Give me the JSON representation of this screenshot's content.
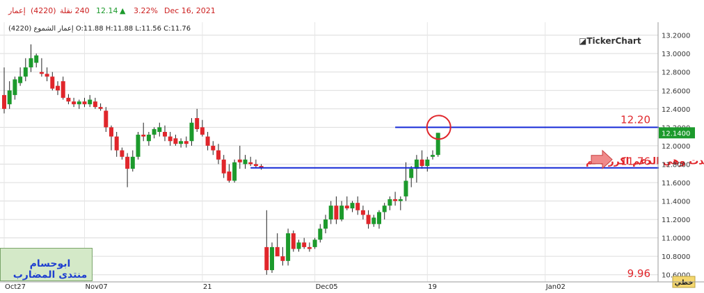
{
  "header": {
    "name": "إعمار",
    "code": "(4220)",
    "volume": "240 نقلة",
    "price": "12.14",
    "change_icon": "triangle-up-icon",
    "change_pct": "3.22%",
    "date": "Dec 16, 2021"
  },
  "ohlc_line": "(4220) إعمار الشموع O:11.88 H:11.88 L:11.56 C:11.76",
  "brand": "TickerChart",
  "author_box": {
    "line1": "ابوحسام",
    "line2": "منتدى المضارب"
  },
  "annotations": {
    "resistance_label": "12.20",
    "support_label": "11.76",
    "bottom_label": "9.96",
    "note": "عدت وهي الدعم اكرر دعم",
    "current_price": "12.1400",
    "mode_label": "خطي"
  },
  "colors": {
    "up": "#1c9a2c",
    "down": "#e0262b",
    "level_line": "#1428d6",
    "annotation": "#e0262b"
  },
  "chart_data": {
    "type": "candlestick",
    "x_tick_labels": [
      "Oct27",
      "Nov07",
      "21",
      "Dec05",
      "19",
      "Jan02"
    ],
    "y_tick_labels": [
      "10.6000",
      "10.8000",
      "11.0000",
      "11.2000",
      "11.4000",
      "11.6000",
      "11.8000",
      "12.0000",
      "12.2000",
      "12.4000",
      "12.6000",
      "12.8000",
      "13.0000",
      "13.2000"
    ],
    "ylim": [
      10.53,
      13.28
    ],
    "horizontal_levels": [
      12.2,
      11.76
    ],
    "candles": [
      {
        "o": 12.55,
        "h": 12.85,
        "l": 12.35,
        "c": 12.4
      },
      {
        "o": 12.45,
        "h": 12.7,
        "l": 12.4,
        "c": 12.6
      },
      {
        "o": 12.55,
        "h": 12.75,
        "l": 12.5,
        "c": 12.72
      },
      {
        "o": 12.68,
        "h": 12.85,
        "l": 12.65,
        "c": 12.75
      },
      {
        "o": 12.75,
        "h": 12.95,
        "l": 12.7,
        "c": 12.85
      },
      {
        "o": 12.85,
        "h": 13.1,
        "l": 12.8,
        "c": 12.95
      },
      {
        "o": 12.9,
        "h": 13.0,
        "l": 12.85,
        "c": 12.98
      },
      {
        "o": 12.8,
        "h": 12.95,
        "l": 12.75,
        "c": 12.78
      },
      {
        "o": 12.78,
        "h": 12.85,
        "l": 12.7,
        "c": 12.75
      },
      {
        "o": 12.75,
        "h": 12.8,
        "l": 12.6,
        "c": 12.62
      },
      {
        "o": 12.65,
        "h": 12.7,
        "l": 12.55,
        "c": 12.6
      },
      {
        "o": 12.7,
        "h": 12.75,
        "l": 12.5,
        "c": 12.52
      },
      {
        "o": 12.52,
        "h": 12.56,
        "l": 12.45,
        "c": 12.48
      },
      {
        "o": 12.48,
        "h": 12.52,
        "l": 12.42,
        "c": 12.45
      },
      {
        "o": 12.45,
        "h": 12.5,
        "l": 12.4,
        "c": 12.48
      },
      {
        "o": 12.48,
        "h": 12.52,
        "l": 12.42,
        "c": 12.45
      },
      {
        "o": 12.45,
        "h": 12.55,
        "l": 12.42,
        "c": 12.5
      },
      {
        "o": 12.48,
        "h": 12.52,
        "l": 12.4,
        "c": 12.42
      },
      {
        "o": 12.42,
        "h": 12.46,
        "l": 12.38,
        "c": 12.4
      },
      {
        "o": 12.38,
        "h": 12.42,
        "l": 12.15,
        "c": 12.2
      },
      {
        "o": 12.2,
        "h": 12.22,
        "l": 11.95,
        "c": 12.1
      },
      {
        "o": 12.1,
        "h": 12.15,
        "l": 11.88,
        "c": 11.95
      },
      {
        "o": 11.95,
        "h": 11.98,
        "l": 11.85,
        "c": 11.88
      },
      {
        "o": 11.88,
        "h": 11.92,
        "l": 11.55,
        "c": 11.75
      },
      {
        "o": 11.75,
        "h": 11.95,
        "l": 11.72,
        "c": 11.88
      },
      {
        "o": 11.88,
        "h": 12.15,
        "l": 11.85,
        "c": 12.12
      },
      {
        "o": 12.12,
        "h": 12.25,
        "l": 12.05,
        "c": 12.1
      },
      {
        "o": 12.05,
        "h": 12.15,
        "l": 12.0,
        "c": 12.12
      },
      {
        "o": 12.12,
        "h": 12.2,
        "l": 12.08,
        "c": 12.18
      },
      {
        "o": 12.15,
        "h": 12.25,
        "l": 12.1,
        "c": 12.2
      },
      {
        "o": 12.15,
        "h": 12.22,
        "l": 12.05,
        "c": 12.1
      },
      {
        "o": 12.1,
        "h": 12.15,
        "l": 12.0,
        "c": 12.05
      },
      {
        "o": 12.08,
        "h": 12.12,
        "l": 12.0,
        "c": 12.02
      },
      {
        "o": 12.02,
        "h": 12.08,
        "l": 11.98,
        "c": 12.05
      },
      {
        "o": 12.05,
        "h": 12.1,
        "l": 11.98,
        "c": 12.02
      },
      {
        "o": 12.05,
        "h": 12.3,
        "l": 12.0,
        "c": 12.25
      },
      {
        "o": 12.3,
        "h": 12.4,
        "l": 12.15,
        "c": 12.18
      },
      {
        "o": 12.2,
        "h": 12.28,
        "l": 12.1,
        "c": 12.12
      },
      {
        "o": 12.1,
        "h": 12.15,
        "l": 11.95,
        "c": 12.0
      },
      {
        "o": 12.0,
        "h": 12.05,
        "l": 11.9,
        "c": 11.95
      },
      {
        "o": 11.95,
        "h": 12.02,
        "l": 11.8,
        "c": 11.85
      },
      {
        "o": 11.85,
        "h": 11.9,
        "l": 11.65,
        "c": 11.7
      },
      {
        "o": 11.72,
        "h": 11.8,
        "l": 11.6,
        "c": 11.62
      },
      {
        "o": 11.62,
        "h": 11.85,
        "l": 11.6,
        "c": 11.82
      },
      {
        "o": 11.85,
        "h": 12.0,
        "l": 11.75,
        "c": 11.82
      },
      {
        "o": 11.8,
        "h": 11.9,
        "l": 11.75,
        "c": 11.85
      },
      {
        "o": 11.82,
        "h": 11.88,
        "l": 11.78,
        "c": 11.8
      },
      {
        "o": 11.8,
        "h": 11.85,
        "l": 11.76,
        "c": 11.78
      },
      {
        "o": 11.78,
        "h": 11.8,
        "l": 11.74,
        "c": 11.76
      },
      {
        "o": 10.9,
        "h": 11.3,
        "l": 10.6,
        "c": 10.65
      },
      {
        "o": 10.65,
        "h": 10.95,
        "l": 10.62,
        "c": 10.9
      },
      {
        "o": 10.9,
        "h": 11.05,
        "l": 10.82,
        "c": 10.8
      },
      {
        "o": 10.8,
        "h": 10.9,
        "l": 10.7,
        "c": 10.75
      },
      {
        "o": 10.75,
        "h": 11.1,
        "l": 10.7,
        "c": 11.05
      },
      {
        "o": 11.05,
        "h": 11.08,
        "l": 10.85,
        "c": 10.88
      },
      {
        "o": 10.88,
        "h": 10.98,
        "l": 10.85,
        "c": 10.95
      },
      {
        "o": 10.95,
        "h": 11.0,
        "l": 10.88,
        "c": 10.9
      },
      {
        "o": 10.9,
        "h": 10.95,
        "l": 10.85,
        "c": 10.88
      },
      {
        "o": 10.9,
        "h": 11.0,
        "l": 10.88,
        "c": 10.98
      },
      {
        "o": 10.98,
        "h": 11.15,
        "l": 10.95,
        "c": 11.1
      },
      {
        "o": 11.1,
        "h": 11.25,
        "l": 11.05,
        "c": 11.2
      },
      {
        "o": 11.2,
        "h": 11.4,
        "l": 11.15,
        "c": 11.35
      },
      {
        "o": 11.35,
        "h": 11.45,
        "l": 11.15,
        "c": 11.2
      },
      {
        "o": 11.2,
        "h": 11.4,
        "l": 11.18,
        "c": 11.35
      },
      {
        "o": 11.35,
        "h": 11.45,
        "l": 11.3,
        "c": 11.32
      },
      {
        "o": 11.32,
        "h": 11.4,
        "l": 11.28,
        "c": 11.38
      },
      {
        "o": 11.38,
        "h": 11.45,
        "l": 11.25,
        "c": 11.3
      },
      {
        "o": 11.3,
        "h": 11.35,
        "l": 11.2,
        "c": 11.25
      },
      {
        "o": 11.25,
        "h": 11.3,
        "l": 11.1,
        "c": 11.15
      },
      {
        "o": 11.15,
        "h": 11.25,
        "l": 11.12,
        "c": 11.22
      },
      {
        "o": 11.15,
        "h": 11.3,
        "l": 11.1,
        "c": 11.28
      },
      {
        "o": 11.28,
        "h": 11.38,
        "l": 11.2,
        "c": 11.35
      },
      {
        "o": 11.35,
        "h": 11.45,
        "l": 11.3,
        "c": 11.42
      },
      {
        "o": 11.42,
        "h": 11.5,
        "l": 11.35,
        "c": 11.4
      },
      {
        "o": 11.4,
        "h": 11.45,
        "l": 11.3,
        "c": 11.42
      },
      {
        "o": 11.45,
        "h": 11.82,
        "l": 11.4,
        "c": 11.62
      },
      {
        "o": 11.65,
        "h": 11.78,
        "l": 11.55,
        "c": 11.75
      },
      {
        "o": 11.75,
        "h": 11.9,
        "l": 11.6,
        "c": 11.85
      },
      {
        "o": 11.85,
        "h": 11.95,
        "l": 11.75,
        "c": 11.78
      },
      {
        "o": 11.78,
        "h": 11.88,
        "l": 11.72,
        "c": 11.85
      },
      {
        "o": 11.88,
        "h": 11.95,
        "l": 11.85,
        "c": 11.9
      },
      {
        "o": 11.9,
        "h": 12.14,
        "l": 11.88,
        "c": 12.14
      }
    ]
  }
}
